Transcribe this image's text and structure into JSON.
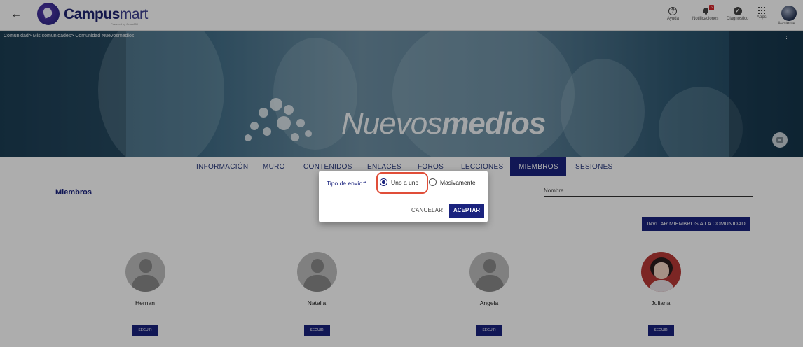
{
  "topbar": {
    "brand_bold": "Campus",
    "brand_light": "mart",
    "brand_sub": "Powered by CrossMill",
    "help_label": "Ayuda",
    "notifications_label": "Notificaciones",
    "notifications_count": "6",
    "diagnostic_label": "Diagnóstico",
    "apps_label": "Apps",
    "user_label": "Asistente"
  },
  "banner": {
    "breadcrumb": "Comunidad> Mis comunidades> Comunidad Nuevosmedios",
    "word_light": "Nuevos",
    "word_bold": "medios"
  },
  "tabs": [
    {
      "label": "INFORMACIÓN"
    },
    {
      "label": "MURO"
    },
    {
      "label": "CONTENIDOS"
    },
    {
      "label": "ENLACES"
    },
    {
      "label": "FOROS"
    },
    {
      "label": "LECCIONES"
    },
    {
      "label": "MIEMBROS",
      "active": true
    },
    {
      "label": "SESIONES"
    }
  ],
  "content": {
    "title": "Miembros",
    "name_placeholder": "Nombre",
    "invite_label": "INVITAR MIEMBROS A LA COMUNIDAD",
    "members": [
      {
        "name": "Hernan",
        "follow": "SEGUIR"
      },
      {
        "name": "Natalia",
        "follow": "SEGUIR"
      },
      {
        "name": "Angela",
        "follow": "SEGUIR"
      },
      {
        "name": "Juliana",
        "follow": "SEGUIR"
      }
    ]
  },
  "dialog": {
    "label": "Tipo de envío:*",
    "option_one": "Uno a uno",
    "option_mass": "Masivamente",
    "selected": "Uno a uno",
    "cancel": "CANCELAR",
    "accept": "ACEPTAR",
    "highlight_color": "#e04e39",
    "accent": "#1a237e"
  }
}
